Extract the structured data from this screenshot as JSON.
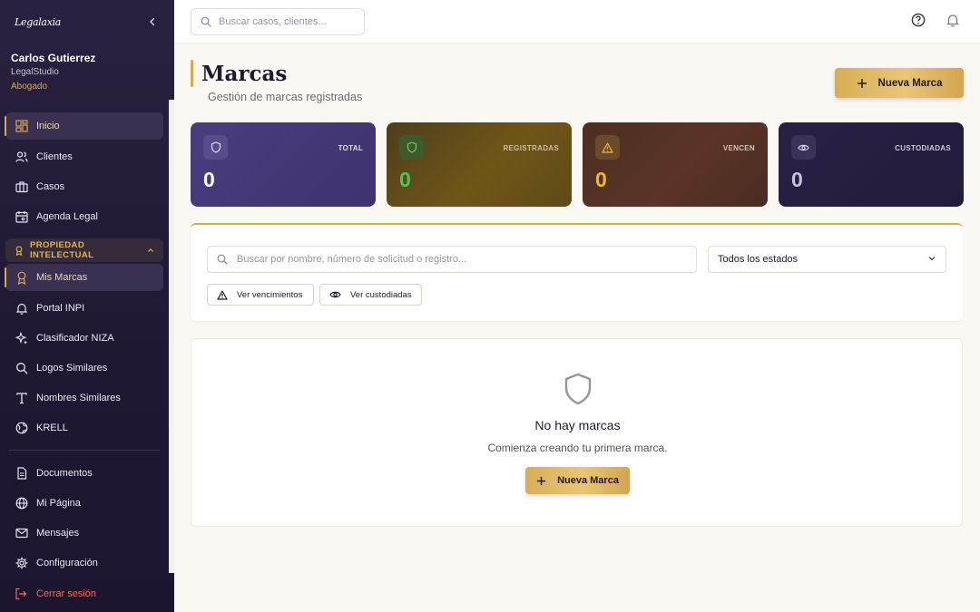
{
  "app": {
    "logo_text": "Legalaxia"
  },
  "user": {
    "name": "Carlos Gutierrez",
    "org": "LegalStudio",
    "role": "Abogado"
  },
  "sidebar": {
    "items_top": [
      {
        "label": "Inicio",
        "icon": "grid-icon"
      },
      {
        "label": "Clientes",
        "icon": "users-icon"
      },
      {
        "label": "Casos",
        "icon": "briefcase-icon"
      },
      {
        "label": "Agenda Legal",
        "icon": "calendar-icon"
      }
    ],
    "section": {
      "label": "PROPIEDAD INTELECTUAL",
      "icon": "award-icon"
    },
    "items_ip": [
      {
        "label": "Mis Marcas",
        "icon": "award-icon"
      },
      {
        "label": "Portal INPI",
        "icon": "bell-icon"
      },
      {
        "label": "Clasificador NIZA",
        "icon": "sparkles-icon"
      },
      {
        "label": "Logos Similares",
        "icon": "search-icon"
      },
      {
        "label": "Nombres Similares",
        "icon": "type-icon"
      },
      {
        "label": "KRELL",
        "icon": "globe-icon"
      }
    ],
    "items_bottom": [
      {
        "label": "Documentos",
        "icon": "document-icon"
      },
      {
        "label": "Mi Página",
        "icon": "globe-icon"
      },
      {
        "label": "Mensajes",
        "icon": "mail-icon"
      },
      {
        "label": "Configuración",
        "icon": "gear-icon"
      }
    ],
    "logout": "Cerrar sesión"
  },
  "topbar": {
    "search_placeholder": "Buscar casos, clientes..."
  },
  "page": {
    "title": "Marcas",
    "subtitle": "Gestión de marcas registradas",
    "new_button": "Nueva Marca"
  },
  "stats": [
    {
      "label": "TOTAL",
      "value": "0",
      "icon": "shield-icon"
    },
    {
      "label": "REGISTRADAS",
      "value": "0",
      "icon": "shield-check-icon"
    },
    {
      "label": "VENCEN",
      "value": "0",
      "icon": "warning-icon"
    },
    {
      "label": "CUSTODIADAS",
      "value": "0",
      "icon": "eye-icon"
    }
  ],
  "filters": {
    "search_placeholder": "Buscar por nombre, número de solicitud o registro...",
    "status_selected": "Todos los estados",
    "btn_vencimientos": "Ver vencimientos",
    "btn_custodiadas": "Ver custodiadas"
  },
  "empty": {
    "title": "No hay marcas",
    "subtitle": "Comienza creando tu primera marca.",
    "button": "Nueva Marca"
  },
  "colors": {
    "accent_gold": "#d8a94a",
    "sidebar_bg": "#2a2140",
    "logout": "#f06b5e"
  }
}
